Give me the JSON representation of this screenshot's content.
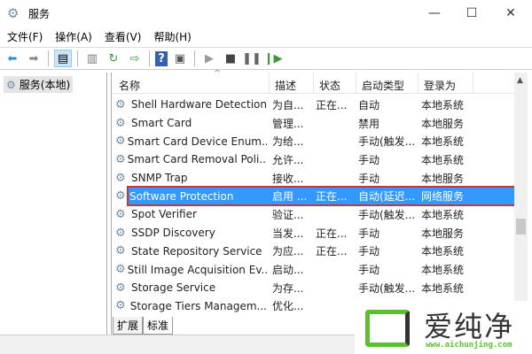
{
  "window": {
    "title": "服务",
    "minimize": "—",
    "maximize": "☐",
    "close": "✕"
  },
  "menu": [
    "文件(F)",
    "操作(A)",
    "查看(V)",
    "帮助(H)"
  ],
  "left": {
    "item": "服务(本地)"
  },
  "columns": [
    "名称",
    "描述",
    "状态",
    "启动类型",
    "登录为"
  ],
  "rows": [
    [
      "Shell Hardware Detection",
      "为自...",
      "正在...",
      "自动",
      "本地系统"
    ],
    [
      "Smart Card",
      "管理...",
      "",
      "禁用",
      "本地服务"
    ],
    [
      "Smart Card Device Enum...",
      "为给...",
      "",
      "手动(触发...",
      "本地系统"
    ],
    [
      "Smart Card Removal Poli...",
      "允许...",
      "",
      "手动",
      "本地系统"
    ],
    [
      "SNMP Trap",
      "接收...",
      "",
      "手动",
      "本地服务"
    ],
    [
      "Software Protection",
      "启用 ...",
      "正在...",
      "自动(延迟...",
      "网络服务"
    ],
    [
      "Spot Verifier",
      "验证...",
      "",
      "手动(触发...",
      "本地系统"
    ],
    [
      "SSDP Discovery",
      "当发...",
      "正在...",
      "手动",
      "本地服务"
    ],
    [
      "State Repository Service",
      "为应...",
      "正在...",
      "手动",
      "本地系统"
    ],
    [
      "Still Image Acquisition Ev...",
      "启动...",
      "",
      "手动",
      "本地系统"
    ],
    [
      "Storage Service",
      "为存...",
      "",
      "手动(触发...",
      "本地系统"
    ],
    [
      "Storage Tiers Managem...",
      "优化...",
      "",
      "",
      ""
    ]
  ],
  "selected_index": 5,
  "tabs": [
    "扩展",
    "标准"
  ],
  "watermark": {
    "name": "爱纯净",
    "url": "www.aichunjing.com"
  }
}
